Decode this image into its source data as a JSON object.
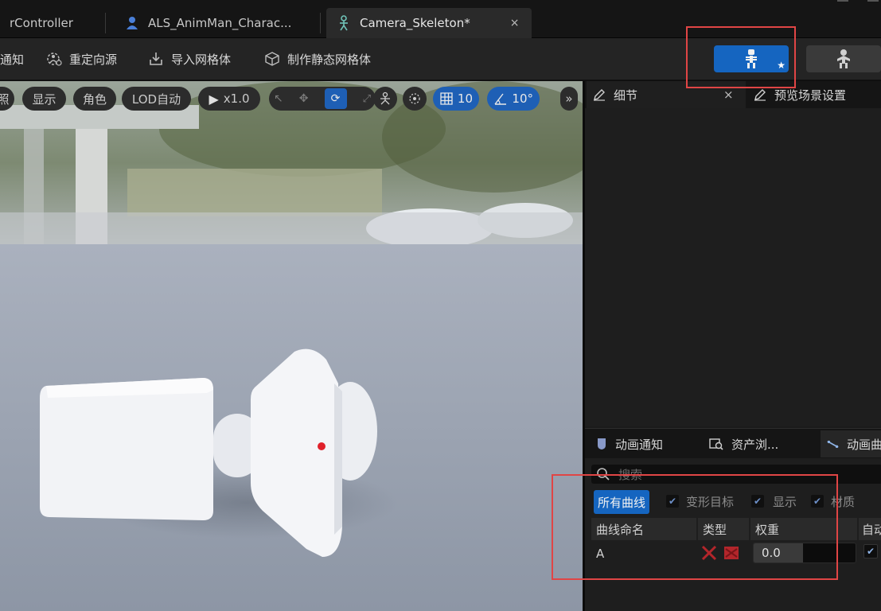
{
  "tabs": [
    {
      "label": "rController",
      "icon": "controller-icon"
    },
    {
      "label": "ALS_AnimMan_Charac...",
      "icon": "character-icon"
    },
    {
      "label": "Camera_Skeleton*",
      "icon": "skeleton-icon",
      "active": true,
      "close": "×"
    }
  ],
  "toolbar": {
    "notify_label": "通知",
    "reorient_label": "重定向源",
    "import_mesh_label": "导入网格体",
    "make_static_label": "制作静态网格体",
    "mode_skeleton_star": "★"
  },
  "viewport_toolbar": {
    "photo_fragment": "照",
    "show": "显示",
    "character": "角色",
    "lod": "LOD自动",
    "speed": "x1.0",
    "grid_value": "10",
    "angle_value": "10°",
    "more": "»"
  },
  "details": {
    "tab_label": "细节",
    "close": "×",
    "preview_tab_label": "预览场景设置"
  },
  "anim_panel": {
    "tab_notify": "动画通知",
    "tab_assets": "资产浏...",
    "tab_curves": "动画曲"
  },
  "curves": {
    "search_placeholder": "搜索",
    "filter_all": "所有曲线",
    "filter_morph": "变形目标",
    "filter_show": "显示",
    "filter_material": "材质",
    "col_name": "曲线命名",
    "col_type": "类型",
    "col_weight": "权重",
    "col_auto": "自动",
    "rows": [
      {
        "name": "A",
        "weight": "0.0",
        "auto": true
      }
    ]
  },
  "colors": {
    "accent_blue": "#1565c0",
    "annotation_red": "#e04545",
    "curve_type_red": "#b3262b"
  }
}
